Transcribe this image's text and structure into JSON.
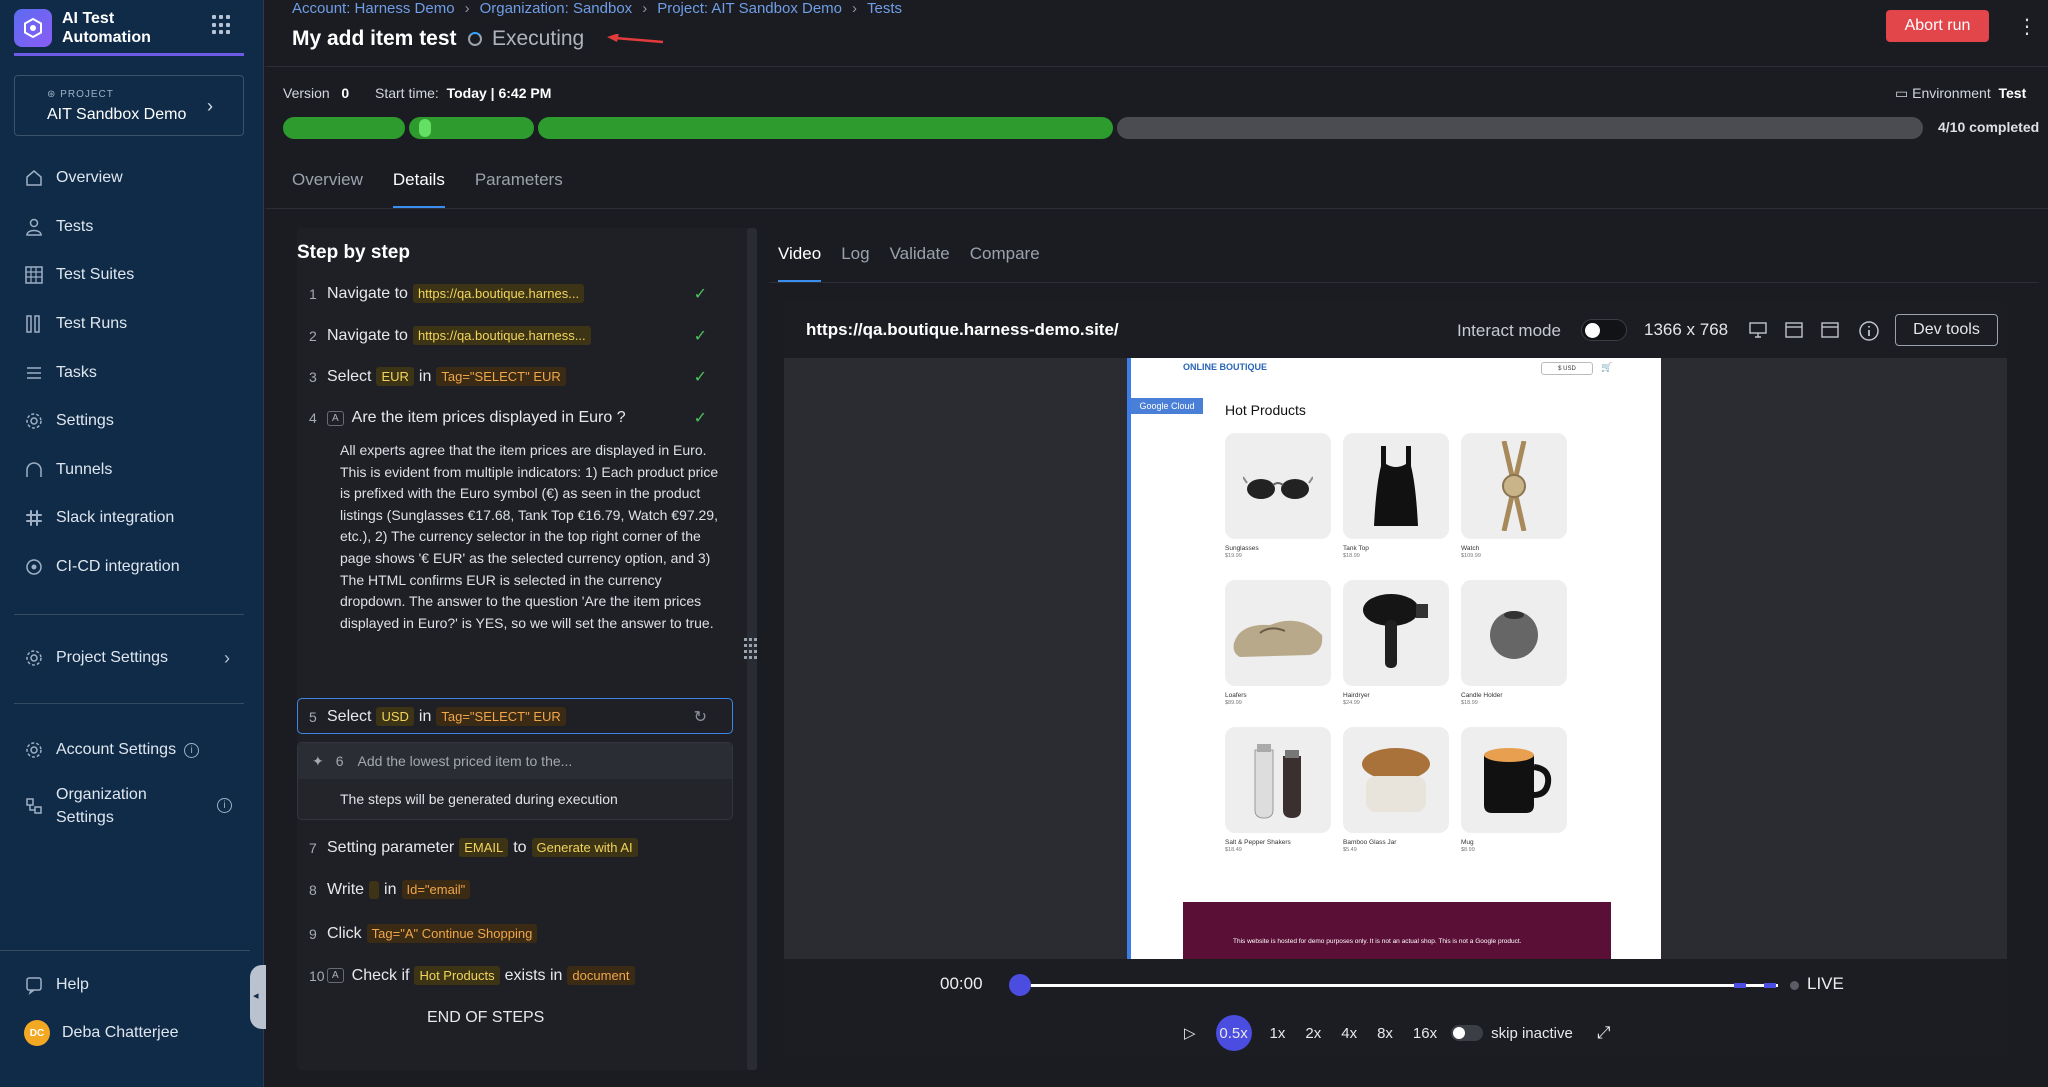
{
  "sidebar": {
    "brand": "AI Test Automation",
    "project_label": "PROJECT",
    "project_name": "AIT Sandbox Demo",
    "nav": [
      {
        "label": "Overview",
        "icon": "home-icon"
      },
      {
        "label": "Tests",
        "icon": "user-icon"
      },
      {
        "label": "Test Suites",
        "icon": "grid-icon"
      },
      {
        "label": "Test Runs",
        "icon": "runs-icon"
      },
      {
        "label": "Tasks",
        "icon": "list-icon"
      },
      {
        "label": "Settings",
        "icon": "gear-icon"
      },
      {
        "label": "Tunnels",
        "icon": "tunnel-icon"
      },
      {
        "label": "Slack integration",
        "icon": "slack-icon"
      },
      {
        "label": "CI-CD integration",
        "icon": "cicd-icon"
      }
    ],
    "project_settings": "Project Settings",
    "account_settings": "Account Settings",
    "org_settings": "Organization Settings",
    "help": "Help",
    "user_initials": "DC",
    "user_name": "Deba Chatterjee"
  },
  "breadcrumb": [
    "Account: Harness Demo",
    "Organization: Sandbox",
    "Project: AIT Sandbox Demo",
    "Tests"
  ],
  "header": {
    "title": "My add item test",
    "status": "Executing",
    "abort_label": "Abort run",
    "version_label": "Version",
    "version_value": "0",
    "start_label": "Start time:",
    "start_value": "Today | 6:42 PM",
    "env_label": "Environment",
    "env_value": "Test",
    "progress_text": "4/10 completed",
    "progress_completed": 4,
    "progress_total": 10
  },
  "tabs": [
    "Overview",
    "Details",
    "Parameters"
  ],
  "steps": {
    "title": "Step by step",
    "items": [
      {
        "num": "1",
        "verb": "Navigate to",
        "tag": "https://qa.boutique.harnes..."
      },
      {
        "num": "2",
        "verb": "Navigate to",
        "tag": "https://qa.boutique.harness..."
      },
      {
        "num": "3",
        "verb": "Select",
        "value": "EUR",
        "in": "in",
        "tag": "Tag=\"SELECT\" EUR"
      },
      {
        "num": "4",
        "badge": "A",
        "verb": "Are the item prices displayed in Euro ?"
      },
      {
        "num": "5",
        "verb": "Select",
        "value": "USD",
        "in": "in",
        "tag": "Tag=\"SELECT\" EUR"
      },
      {
        "num": "6",
        "verb": "Add the lowest priced item to the..."
      },
      {
        "num": "7",
        "verb": "Setting parameter",
        "value": "EMAIL",
        "in": "to",
        "tag": "Generate with AI"
      },
      {
        "num": "8",
        "verb": "Write",
        "value": "",
        "in": "in",
        "tag": "Id=\"email\""
      },
      {
        "num": "9",
        "verb": "Click",
        "tag": "Tag=\"A\" Continue Shopping"
      },
      {
        "num": "10",
        "badge": "A",
        "verb": "Check if",
        "value": "Hot Products",
        "in": "exists in",
        "tag": "document"
      }
    ],
    "step4_description": "All experts agree that the item prices are displayed in Euro. This is evident from multiple indicators: 1) Each product price is prefixed with the Euro symbol (€) as seen in the product listings (Sunglasses €17.68, Tank Top €16.79, Watch €97.29, etc.), 2) The currency selector in the top right corner of the page shows '€ EUR' as the selected currency option, and 3) The HTML confirms EUR is selected in the currency dropdown. The answer to the question 'Are the item prices displayed in Euro?' is YES, so we will set the answer to true.",
    "step6_note": "The steps will be generated during execution",
    "end_label": "END OF STEPS"
  },
  "video": {
    "tabs": [
      "Video",
      "Log",
      "Validate",
      "Compare"
    ],
    "url": "https://qa.boutique.harness-demo.site/",
    "interact_label": "Interact mode",
    "resolution": "1366 x 768",
    "devtools_label": "Dev tools",
    "time": "00:00",
    "live_label": "LIVE",
    "speeds": [
      "0.5x",
      "1x",
      "2x",
      "4x",
      "8x",
      "16x"
    ],
    "skip_label": "skip inactive"
  },
  "site": {
    "logo": "ONLINE BOUTIQUE",
    "currency": "$ USD",
    "badge": "Google Cloud",
    "heading": "Hot Products",
    "products": [
      {
        "name": "Sunglasses",
        "price": "$19.99"
      },
      {
        "name": "Tank Top",
        "price": "$18.99"
      },
      {
        "name": "Watch",
        "price": "$109.99"
      },
      {
        "name": "Loafers",
        "price": "$89.99"
      },
      {
        "name": "Hairdryer",
        "price": "$24.99"
      },
      {
        "name": "Candle Holder",
        "price": "$18.99"
      },
      {
        "name": "Salt & Pepper Shakers",
        "price": "$18.49"
      },
      {
        "name": "Bamboo Glass Jar",
        "price": "$5.49"
      },
      {
        "name": "Mug",
        "price": "$8.99"
      }
    ],
    "footer": "This website is hosted for demo purposes only. It is not an actual shop. This is not a Google product."
  },
  "colors": {
    "sidebar_bg": "#0f2b48",
    "accent": "#3b8df0",
    "success": "#2e9b2e",
    "danger": "#e2454a"
  }
}
